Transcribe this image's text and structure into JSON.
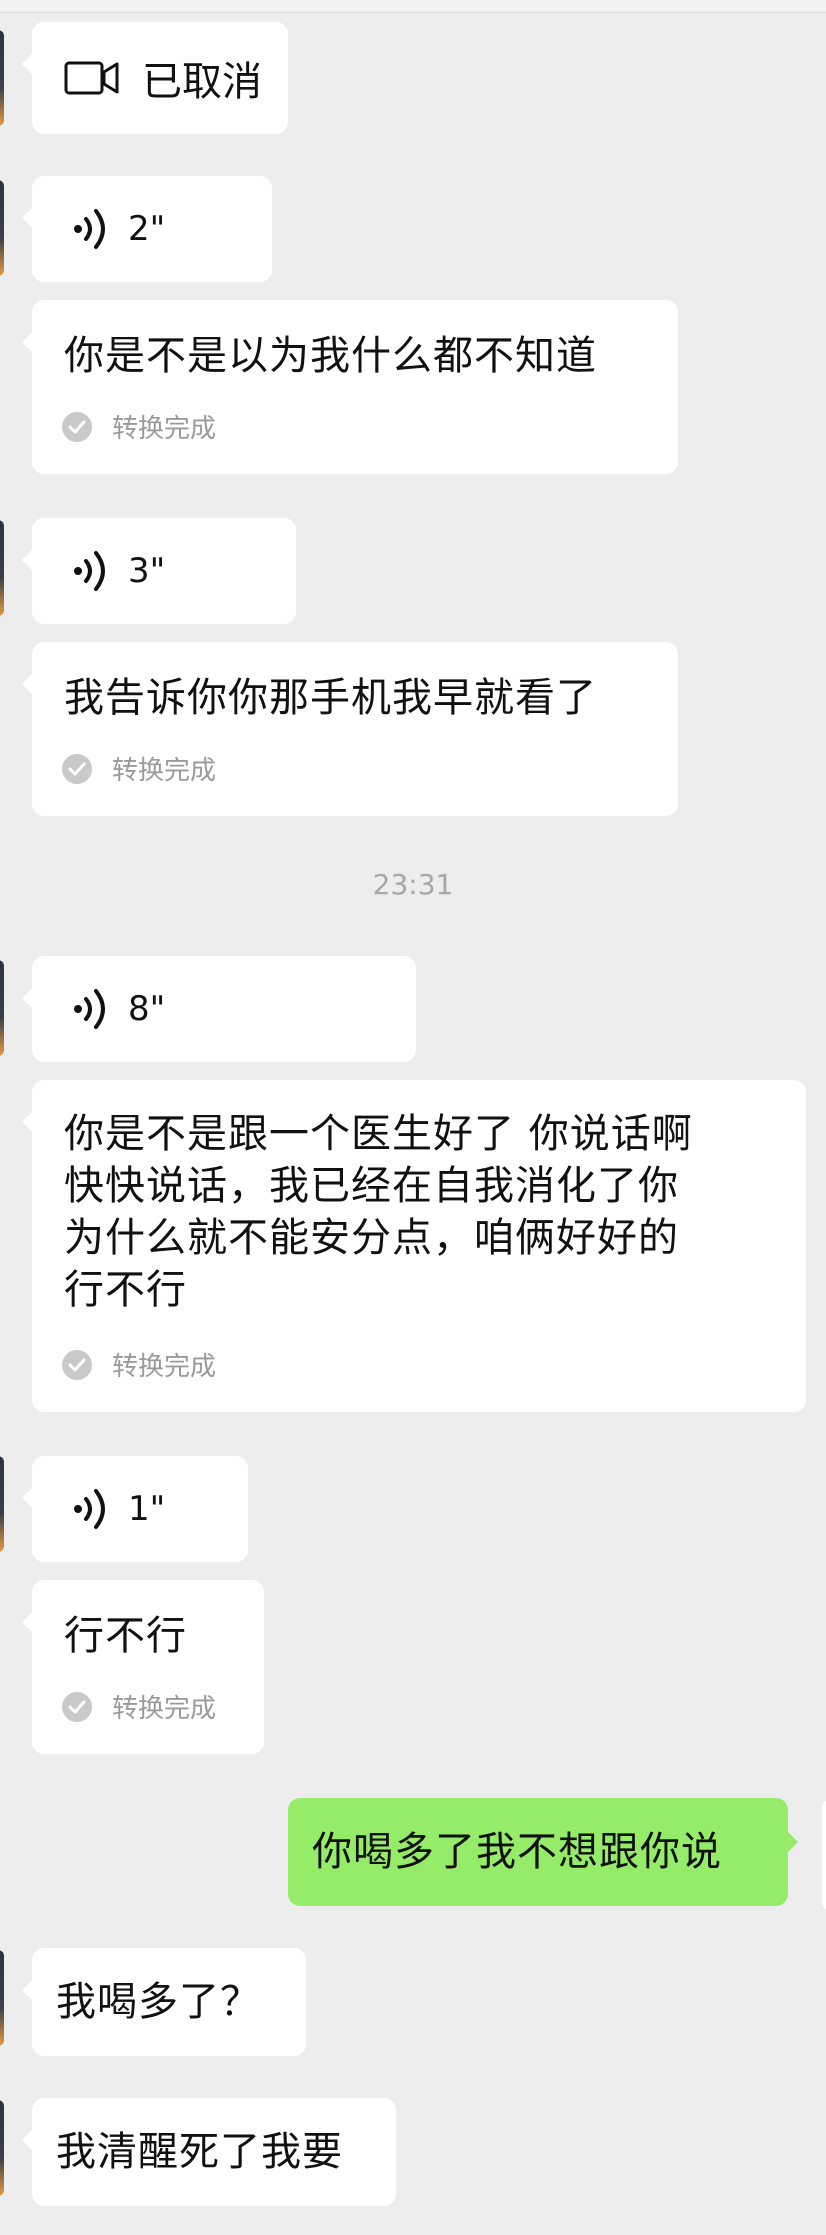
{
  "colors": {
    "background": "#EDEDED",
    "bubble_received": "#FFFFFF",
    "bubble_sent": "#95EC69",
    "secondary_text": "#9A9A9A"
  },
  "messages": [
    {
      "kind": "video-call",
      "icon": "video-camera-icon",
      "text": "已取消"
    },
    {
      "kind": "voice",
      "icon": "voice-wave-icon",
      "duration": "2\""
    },
    {
      "kind": "transcript",
      "text": "你是不是以为我什么都不知道",
      "status": "转换完成"
    },
    {
      "kind": "voice",
      "icon": "voice-wave-icon",
      "duration": "3\""
    },
    {
      "kind": "transcript",
      "text": "我告诉你你那手机我早就看了",
      "status": "转换完成"
    },
    {
      "kind": "timestamp",
      "text": "23:31"
    },
    {
      "kind": "voice",
      "icon": "voice-wave-icon",
      "duration": "8\""
    },
    {
      "kind": "transcript",
      "lines": [
        "你是不是跟一个医生好了 你说话啊",
        "快快说话，我已经在自我消化了你",
        "为什么就不能安分点，咱俩好好的",
        "行不行"
      ],
      "status": "转换完成"
    },
    {
      "kind": "voice",
      "icon": "voice-wave-icon",
      "duration": "1\""
    },
    {
      "kind": "transcript",
      "text": "行不行",
      "status": "转换完成"
    },
    {
      "kind": "sent-text",
      "text": "你喝多了我不想跟你说"
    },
    {
      "kind": "text",
      "text": "我喝多了？"
    },
    {
      "kind": "text",
      "text": "我清醒死了我要"
    }
  ]
}
